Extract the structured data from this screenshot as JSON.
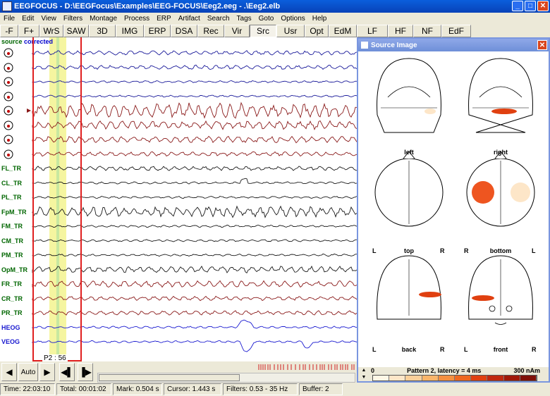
{
  "window": {
    "title": "EEGFOCUS - D:\\EEGFocus\\Examples\\EEG-FOCUS\\Eeg2.eeg - .\\Eeg2.elb",
    "minimize": "_",
    "maximize": "□",
    "close": "✕"
  },
  "menu": [
    "File",
    "Edit",
    "View",
    "Filters",
    "Montage",
    "Process",
    "ERP",
    "Artifact",
    "Search",
    "Tags",
    "Goto",
    "Options",
    "Help"
  ],
  "toolbar": [
    {
      "label": "-F"
    },
    {
      "label": "F+"
    },
    {
      "label": "WrS"
    },
    {
      "label": "SAW"
    },
    {
      "label": "3D"
    },
    {
      "label": "IMG"
    },
    {
      "label": "ERP"
    },
    {
      "label": "DSA"
    },
    {
      "label": "Rec"
    },
    {
      "label": "Vir"
    },
    {
      "label": "Src"
    },
    {
      "label": "Usr"
    },
    {
      "label": "Opt"
    },
    {
      "label": "EdM"
    },
    {
      "label": "LF"
    },
    {
      "label": "HF"
    },
    {
      "label": "NF"
    },
    {
      "label": "EdF"
    }
  ],
  "eeg": {
    "source_label_a": "source",
    "source_label_b": "corrected",
    "marker_label": "P2 : 56",
    "channels": [
      {
        "label": "",
        "color": "#1a1a9a",
        "amp": 2
      },
      {
        "label": "",
        "color": "#1a1a9a",
        "amp": 2
      },
      {
        "label": "",
        "color": "#1a1a9a",
        "amp": 1
      },
      {
        "label": "",
        "color": "#1a1a9a",
        "amp": 1
      },
      {
        "label": "",
        "color": "#8a1a1a",
        "amp": 7
      },
      {
        "label": "",
        "color": "#8a1a1a",
        "amp": 4
      },
      {
        "label": "",
        "color": "#8a1a1a",
        "amp": 3
      },
      {
        "label": "",
        "color": "#8a1a1a",
        "amp": 2
      },
      {
        "label": "FL_TR",
        "color": "#1a1a1a",
        "amp": 2
      },
      {
        "label": "CL_TR",
        "color": "#1a1a1a",
        "amp": 1
      },
      {
        "label": "PL_TR",
        "color": "#1a1a1a",
        "amp": 1
      },
      {
        "label": "FpM_TR",
        "color": "#1a1a1a",
        "amp": 5
      },
      {
        "label": "FM_TR",
        "color": "#1a1a1a",
        "amp": 1
      },
      {
        "label": "CM_TR",
        "color": "#1a1a1a",
        "amp": 1
      },
      {
        "label": "PM_TR",
        "color": "#1a1a1a",
        "amp": 1
      },
      {
        "label": "OpM_TR",
        "color": "#1a1a1a",
        "amp": 3
      },
      {
        "label": "FR_TR",
        "color": "#8a1a1a",
        "amp": 3
      },
      {
        "label": "CR_TR",
        "color": "#8a1a1a",
        "amp": 2
      },
      {
        "label": "PR_TR",
        "color": "#8a1a1a",
        "amp": 2
      },
      {
        "label": "HEOG",
        "color": "#1a1ad0",
        "amp": 1
      },
      {
        "label": "VEOG",
        "color": "#1a1ad0",
        "amp": 1
      }
    ]
  },
  "scroll": {
    "auto_label": "Auto",
    "btn_first": "◀",
    "btn_prev": "▶",
    "btn_back": "◀▌",
    "btn_next": "▐▶"
  },
  "status": {
    "time": "Time: 22:03:10",
    "total": "Total: 00:01:02",
    "mark": "Mark: 0.504 s",
    "cursor": "Cursor: 1.443 s",
    "filters": "Filters: 0.53 - 35 Hz",
    "buffer": "Buffer: 2"
  },
  "source_window": {
    "title": "Source Image",
    "close": "✕",
    "views": [
      {
        "name": "left",
        "l": "",
        "r": ""
      },
      {
        "name": "right",
        "l": "",
        "r": ""
      },
      {
        "name": "top",
        "l": "L",
        "r": "R"
      },
      {
        "name": "bottom",
        "l": "R",
        "r": "L"
      },
      {
        "name": "back",
        "l": "L",
        "r": "R"
      },
      {
        "name": "front",
        "l": "L",
        "r": "R"
      }
    ],
    "colorbar_min": "0",
    "colorbar_caption": "Pattern 2, latency = 4 ms",
    "colorbar_max": "300 nAm",
    "colorbar_colors": [
      "#fff7e6",
      "#fde6c8",
      "#fbd09a",
      "#f9b56a",
      "#f59040",
      "#ee6820",
      "#e04010",
      "#c02810",
      "#a01808",
      "#801008"
    ],
    "spin_up": "▲",
    "spin_down": "▼"
  }
}
